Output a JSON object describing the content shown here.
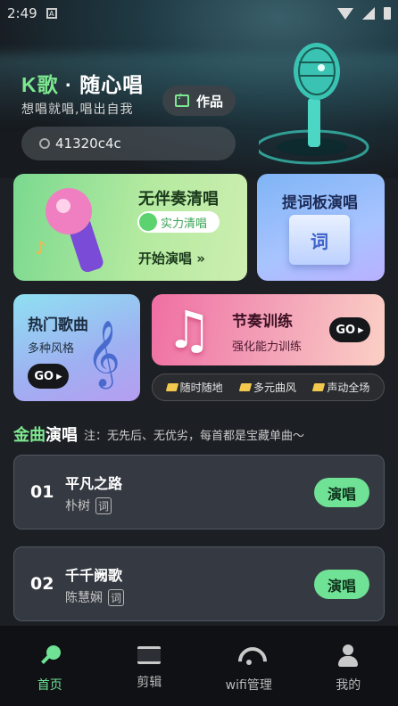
{
  "status_bar": {
    "time": "2:49",
    "notice_icon": "A"
  },
  "header": {
    "title_k": "K歌",
    "title_rest": " · 随心唱",
    "subtitle": "想唱就唱,唱出自我",
    "works_label": "作品",
    "search_value": "41320c4c"
  },
  "cards": {
    "accompaniment": {
      "title": "无伴奏清唱",
      "toggle_label": "实力清唱",
      "start_label": "开始演唱 »"
    },
    "prompter": {
      "title": "提词板演唱",
      "board_char": "词"
    },
    "hot_songs": {
      "title": "热门歌曲",
      "subtitle": "多种风格",
      "go_label": "GO"
    },
    "rhythm": {
      "title": "节奏训练",
      "subtitle": "强化能力训练",
      "go_label": "GO"
    }
  },
  "tags": [
    "随时随地",
    "多元曲风",
    "声动全场"
  ],
  "section": {
    "title_g": "金曲",
    "title_rest": "演唱",
    "note": "注：无先后、无优劣，每首都是宝藏单曲～"
  },
  "songs": [
    {
      "num": "01",
      "name": "平凡之路",
      "artist": "朴树",
      "lyric_tag": "词",
      "action": "演唱"
    },
    {
      "num": "02",
      "name": "千千阙歌",
      "artist": "陈慧娴",
      "lyric_tag": "词",
      "action": "演唱"
    }
  ],
  "tabbar": [
    {
      "label": "首页",
      "icon": "home-mic-icon",
      "active": true
    },
    {
      "label": "剪辑",
      "icon": "film-edit-icon",
      "active": false
    },
    {
      "label": "wifi管理",
      "icon": "wifi-icon",
      "active": false
    },
    {
      "label": "我的",
      "icon": "profile-icon",
      "active": false
    }
  ],
  "colors": {
    "accent": "#6fe295",
    "background": "#1c1f24",
    "song_card": "#353a42"
  }
}
